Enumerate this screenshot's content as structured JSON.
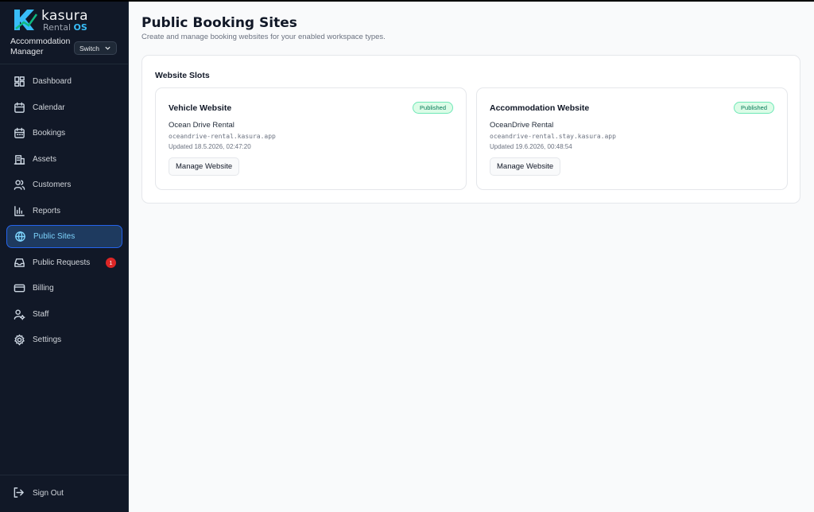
{
  "brand": {
    "name": "kasura",
    "sub_prefix": "Rental ",
    "sub_suffix": "OS"
  },
  "workspace": {
    "label": "Accommodation Manager",
    "switch_label": "Switch"
  },
  "nav": [
    {
      "label": "Dashboard",
      "icon": "dashboard-icon"
    },
    {
      "label": "Calendar",
      "icon": "calendar-icon"
    },
    {
      "label": "Bookings",
      "icon": "bookings-icon"
    },
    {
      "label": "Assets",
      "icon": "assets-icon"
    },
    {
      "label": "Customers",
      "icon": "customers-icon"
    },
    {
      "label": "Reports",
      "icon": "reports-icon"
    },
    {
      "label": "Public Sites",
      "icon": "globe-icon",
      "active": true
    },
    {
      "label": "Public Requests",
      "icon": "inbox-icon",
      "badge": "1"
    },
    {
      "label": "Billing",
      "icon": "credit-card-icon"
    },
    {
      "label": "Staff",
      "icon": "staff-icon"
    },
    {
      "label": "Settings",
      "icon": "gear-icon"
    }
  ],
  "signout": {
    "label": "Sign Out",
    "icon": "sign-out-icon"
  },
  "page": {
    "title": "Public Booking Sites",
    "subtitle": "Create and manage booking websites for your enabled workspace types."
  },
  "slots": {
    "title": "Website Slots",
    "cards": [
      {
        "title": "Vehicle Website",
        "status": "Published",
        "name": "Ocean Drive Rental",
        "domain": "oceandrive-rental.kasura.app",
        "updated": "Updated 18.5.2026, 02:47:20",
        "button": "Manage Website"
      },
      {
        "title": "Accommodation Website",
        "status": "Published",
        "name": "OceanDrive Rental",
        "domain": "oceandrive-rental.stay.kasura.app",
        "updated": "Updated 19.6.2026, 00:48:54",
        "button": "Manage Website"
      }
    ]
  },
  "colors": {
    "sidebar": "#111827",
    "accent": "#38bdf8",
    "published": "#047857",
    "badge": "#dc2626"
  }
}
